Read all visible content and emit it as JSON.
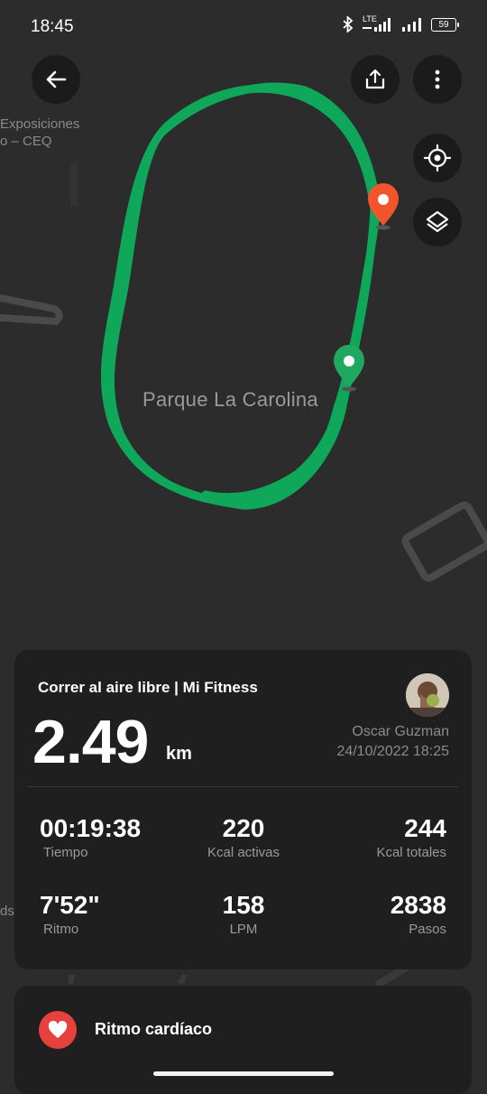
{
  "status_bar": {
    "time": "18:45",
    "network": "LTE",
    "battery": "59"
  },
  "map": {
    "labels": {
      "top_left_line1": "Exposiciones",
      "top_left_line2": "o – CEQ",
      "bottom_left": "ds"
    },
    "park_name": "Parque La Carolina",
    "route_color": "#0fa85a",
    "end_marker_color": "#f2552c",
    "start_marker_color": "#1fa85f"
  },
  "toolbar": {
    "back_icon": "arrow-left-icon",
    "share_icon": "share-icon",
    "more_icon": "more-vertical-icon",
    "locate_icon": "target-icon",
    "layers_icon": "layers-icon"
  },
  "workout": {
    "title": "Correr al aire libre | Mi Fitness",
    "distance": "2.49",
    "distance_unit": "km",
    "user_name": "Oscar Guzman",
    "date_time": "24/10/2022 18:25",
    "stats": [
      {
        "value": "00:19:38",
        "label": "Tiempo"
      },
      {
        "value": "220",
        "label": "Kcal activas"
      },
      {
        "value": "244",
        "label": "Kcal totales"
      },
      {
        "value": "7'52\"",
        "label": "Ritmo"
      },
      {
        "value": "158",
        "label": "LPM"
      },
      {
        "value": "2838",
        "label": "Pasos"
      }
    ]
  },
  "heart_rate": {
    "title": "Ritmo cardíaco",
    "icon": "heart-icon",
    "color": "#e8413d"
  }
}
